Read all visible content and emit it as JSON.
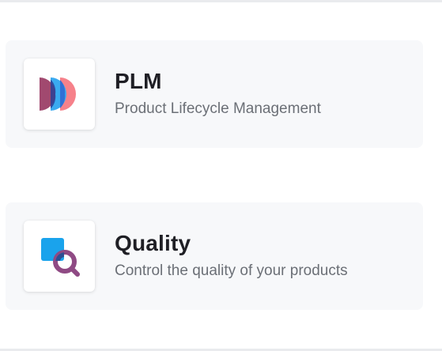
{
  "apps": [
    {
      "title": "PLM",
      "description": "Product Lifecycle Management",
      "icon": "plm-icon"
    },
    {
      "title": "Quality",
      "description": "Control the quality of your products",
      "icon": "quality-magnifier-icon"
    }
  ],
  "colors": {
    "card_background": "#f7f8fa",
    "plm_purple": "#a1496f",
    "plm_blue": "#3aaaf0",
    "plm_coral": "#f6818a",
    "quality_blue": "#1aa3ec",
    "quality_purple": "#8f4a84",
    "title_text": "#1f1f25",
    "description_text": "#6b6f76"
  }
}
